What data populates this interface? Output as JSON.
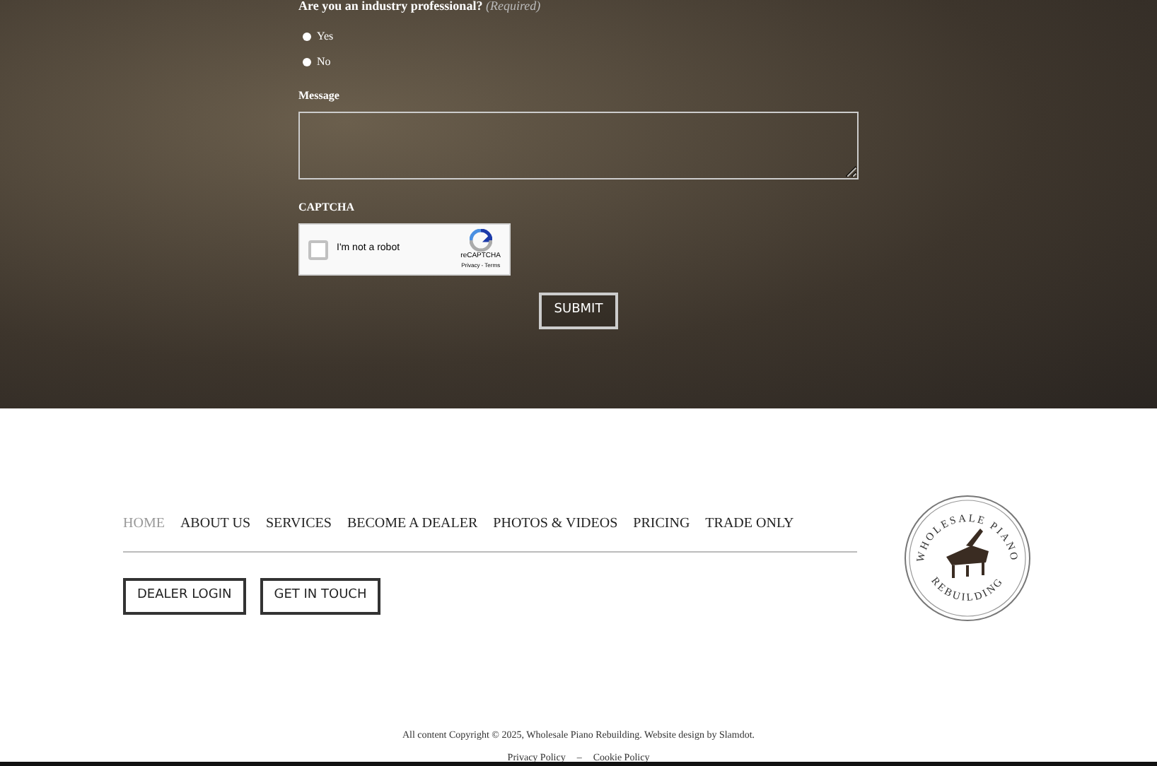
{
  "form": {
    "question": {
      "label": "Are you an industry professional?",
      "note": "(Required)"
    },
    "options": [
      {
        "label": "Yes",
        "selected": false
      },
      {
        "label": "No",
        "selected": false
      }
    ],
    "message": {
      "label": "Message"
    },
    "captcha": {
      "label": "CAPTCHA",
      "checked": false,
      "text": "I'm not a robot",
      "brand": "reCAPTCHA",
      "links": "Privacy - Terms"
    },
    "submit": "SUBMIT"
  },
  "footer": {
    "nav": [
      {
        "label": "HOME",
        "selected": true
      },
      {
        "label": "ABOUT US",
        "selected": false
      },
      {
        "label": "SERVICES",
        "selected": false
      },
      {
        "label": "BECOME A DEALER",
        "selected": false
      },
      {
        "label": "PHOTOS & VIDEOS",
        "selected": false
      },
      {
        "label": "PRICING",
        "selected": false
      },
      {
        "label": "TRADE ONLY",
        "selected": false
      }
    ],
    "buttons": [
      "DEALER LOGIN",
      "GET IN TOUCH"
    ],
    "logo": {
      "top": "WHOLESALE PIANO",
      "bottom": "REBUILDING"
    },
    "copyright": "All content Copyright © 2025, Wholesale Piano Rebuilding. Website design by Slamdot.",
    "links": [
      "Privacy Policy",
      "Cookie Policy"
    ],
    "separator": "–"
  }
}
